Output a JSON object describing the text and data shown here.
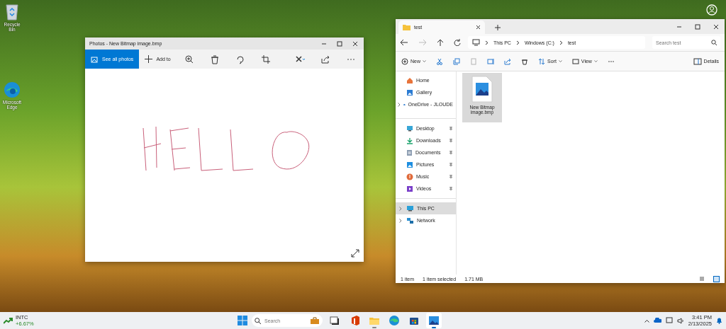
{
  "desktop_icons": [
    {
      "label": "Recycle Bin",
      "kind": "recycle"
    },
    {
      "label": "Microsoft Edge",
      "kind": "edge"
    }
  ],
  "photos_window": {
    "title": "Photos - New Bitmap image.bmp",
    "toolbar": [
      {
        "kind": "see-all",
        "label": "See all photos",
        "selected": true
      },
      {
        "kind": "add",
        "label": "Add to",
        "selected": false
      },
      {
        "kind": "zoom",
        "selected": false
      },
      {
        "kind": "delete",
        "selected": false
      },
      {
        "kind": "rotate",
        "selected": false
      },
      {
        "kind": "crop",
        "selected": false
      },
      {
        "kind": "edit",
        "selected": false
      },
      {
        "kind": "share",
        "selected": false
      },
      {
        "kind": "more",
        "selected": false
      }
    ]
  },
  "explorer_window": {
    "tabs": [
      {
        "label": "test",
        "selected": true
      }
    ],
    "breadcrumb": [
      "This PC",
      "Windows (C:)",
      "test"
    ],
    "search": {
      "placeholder": "Search test"
    },
    "commands": [
      {
        "kind": "new",
        "label": "New",
        "disabled": false
      },
      {
        "kind": "cut",
        "disabled": false
      },
      {
        "kind": "copy",
        "disabled": false
      },
      {
        "kind": "paste",
        "disabled": true
      },
      {
        "kind": "rename",
        "disabled": false
      },
      {
        "kind": "share",
        "disabled": false
      },
      {
        "kind": "delete",
        "disabled": false
      },
      {
        "kind": "sort",
        "label": "Sort",
        "disabled": false
      },
      {
        "kind": "view",
        "label": "View",
        "disabled": false
      },
      {
        "kind": "more",
        "disabled": false
      },
      {
        "kind": "details",
        "label": "Details",
        "disabled": false
      }
    ],
    "sidebar": [
      [
        {
          "label": "Home",
          "kind": "home",
          "expandable": false,
          "pinned": false,
          "selected": false
        },
        {
          "label": "Gallery",
          "kind": "gallery",
          "expandable": false,
          "pinned": false,
          "selected": false
        },
        {
          "label": "OneDrive - JLOUDE",
          "kind": "cloud",
          "expandable": true,
          "pinned": false,
          "selected": false
        }
      ],
      [
        {
          "label": "Desktop",
          "kind": "desktop",
          "expandable": false,
          "pinned": true,
          "selected": false
        },
        {
          "label": "Downloads",
          "kind": "downloads",
          "expandable": false,
          "pinned": true,
          "selected": false
        },
        {
          "label": "Documents",
          "kind": "documents",
          "expandable": false,
          "pinned": true,
          "selected": false
        },
        {
          "label": "Pictures",
          "kind": "pictures",
          "expandable": false,
          "pinned": true,
          "selected": false
        },
        {
          "label": "Music",
          "kind": "music",
          "expandable": false,
          "pinned": true,
          "selected": false
        },
        {
          "label": "Videos",
          "kind": "videos",
          "expandable": false,
          "pinned": true,
          "selected": false
        }
      ],
      [
        {
          "label": "This PC",
          "kind": "pc",
          "expandable": true,
          "pinned": false,
          "selected": true
        },
        {
          "label": "Network",
          "kind": "network",
          "expandable": true,
          "pinned": false,
          "selected": false
        }
      ]
    ],
    "files": [
      {
        "name": "New Bitmap image.bmp",
        "selected": true
      }
    ],
    "status_bar": [
      "1 item",
      "1 item selected",
      "1.71 MB"
    ]
  },
  "taskbar": {
    "stock": {
      "ticker": "INTC",
      "change": "+6.67%"
    },
    "search": {
      "placeholder": "Search"
    },
    "apps": [
      {
        "kind": "task",
        "running": false,
        "selected": false
      },
      {
        "kind": "office",
        "running": false,
        "selected": false
      },
      {
        "kind": "explorer",
        "running": true,
        "selected": false
      },
      {
        "kind": "edge",
        "running": false,
        "selected": false
      },
      {
        "kind": "store",
        "running": false,
        "selected": false
      },
      {
        "kind": "photos",
        "running": true,
        "selected": true
      }
    ],
    "clock": {
      "time": "3:41 PM",
      "date": "2/13/2025"
    }
  }
}
